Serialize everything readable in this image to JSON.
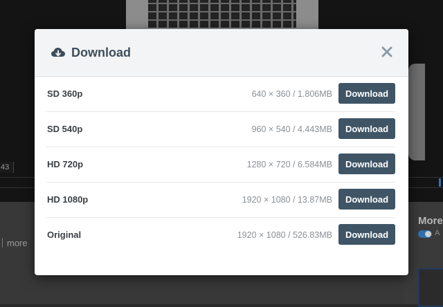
{
  "background": {
    "video_time": "43",
    "more_link": "more",
    "side_title": "More",
    "toggle_label": "A"
  },
  "modal": {
    "title": "Download",
    "close_icon": "close-icon",
    "header_icon": "cloud-download-icon",
    "rows": [
      {
        "label": "SD 360p",
        "info": "640 × 360 / 1.806MB",
        "button": "Download"
      },
      {
        "label": "SD 540p",
        "info": "960 × 540 / 4.443MB",
        "button": "Download"
      },
      {
        "label": "HD 720p",
        "info": "1280 × 720 / 6.584MB",
        "button": "Download"
      },
      {
        "label": "HD 1080p",
        "info": "1920 × 1080 / 13.87MB",
        "button": "Download"
      },
      {
        "label": "Original",
        "info": "1920 × 1080 / 526.83MB",
        "button": "Download"
      }
    ]
  },
  "colors": {
    "button_bg": "#3f5566",
    "title_text": "#3d4e5c",
    "accent_blue": "#2f6fad"
  }
}
